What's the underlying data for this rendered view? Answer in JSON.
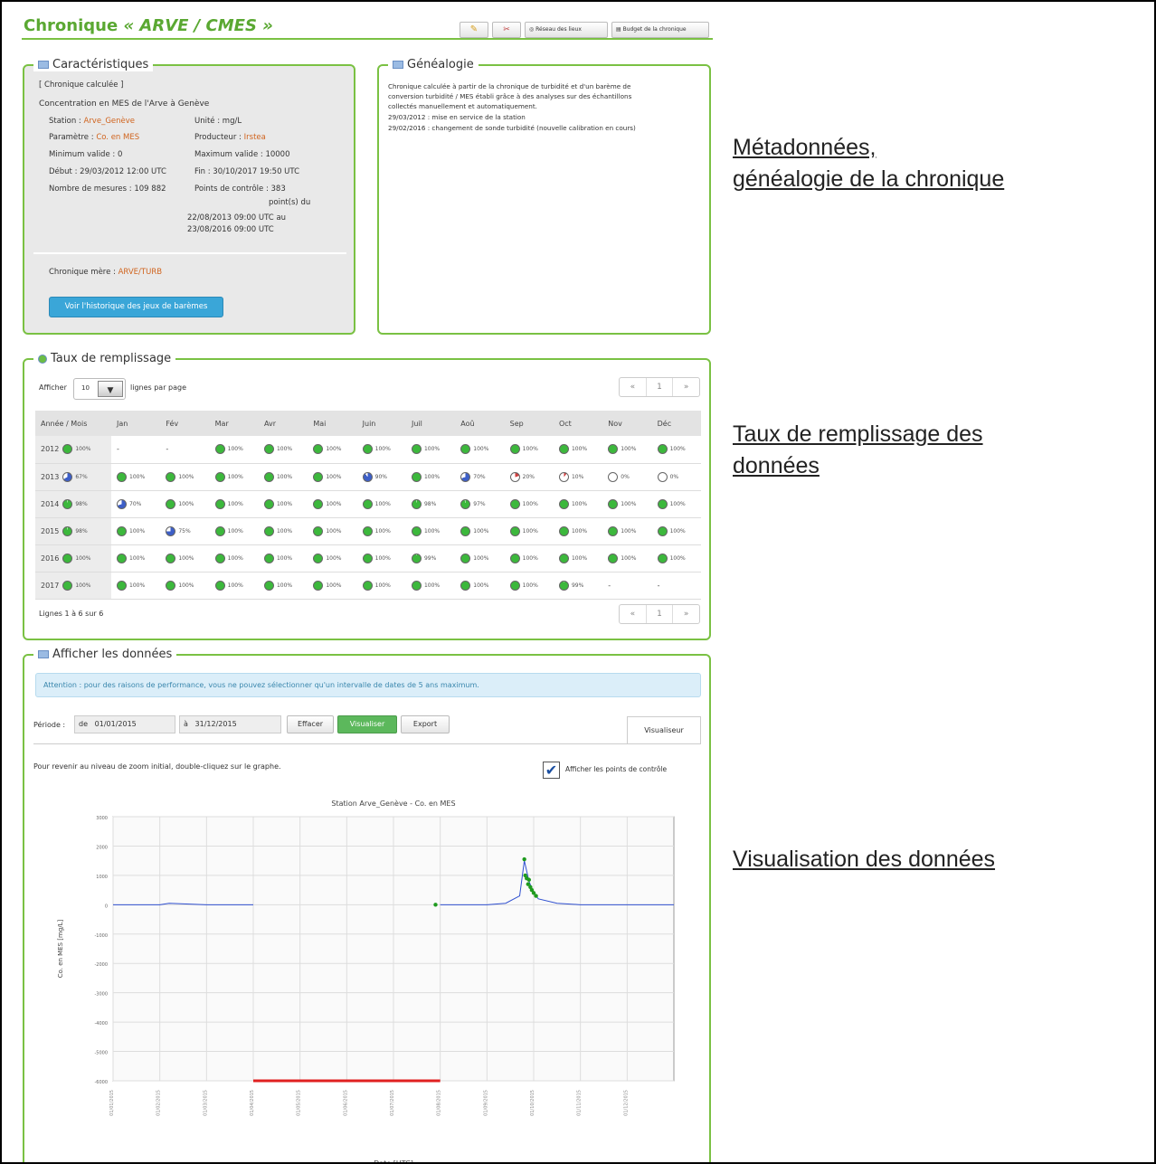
{
  "app": {
    "title_prefix": "Chronique ",
    "title_name": "« ARVE / CMES »",
    "toolbar": {
      "edit_icon": "pencil-icon",
      "extra_icon": "tools-icon",
      "network_label": "Réseau des lieux",
      "budget_label": "Budget de la chronique"
    }
  },
  "characteristics": {
    "legend": "Caractéristiques",
    "type": "[ Chronique calculée ]",
    "concentration": "Concentration en MES de l'Arve à Genève",
    "station_label": "Station :",
    "station_value": "Arve_Genève",
    "unit": "Unité : mg/L",
    "param_label": "Paramètre :",
    "param_value": "Co. en MES",
    "producer_label": "Producteur :",
    "producer_value": "Irstea",
    "min_valid": "Minimum valide : 0",
    "max_valid": "Maximum valide : 10000",
    "start": "Début : 29/03/2012 12:00 UTC",
    "end": "Fin : 30/10/2017 19:50 UTC",
    "measures": "Nombre de mesures : 109 882",
    "control1": "Points de contrôle : 383",
    "control2": "point(s) du",
    "control3": "22/08/2013 09:00 UTC au",
    "control4": "23/08/2016 09:00 UTC",
    "mother_label": "Chronique mère :",
    "mother_value": "ARVE/TURB",
    "history_button": "Voir l'historique des jeux de barèmes"
  },
  "genealogy": {
    "legend": "Généalogie",
    "lines": [
      "Chronique calculée à partir de la chronique de turbidité et d'un barème de",
      "conversion turbidité / MES établi grâce à des analyses sur des échantillons",
      "collectés manuellement et automatiquement.",
      "29/03/2012 : mise en service de la station",
      "29/02/2016 : changement de sonde turbidité (nouvelle calibration en cours)"
    ]
  },
  "fill": {
    "legend": "Taux de remplissage",
    "show_label": "Afficher",
    "per_page_value": "10",
    "per_page_suffix": "lignes par page",
    "headers": [
      "Année / Mois",
      "Jan",
      "Fév",
      "Mar",
      "Avr",
      "Mai",
      "Juin",
      "Juil",
      "Aoû",
      "Sep",
      "Oct",
      "Nov",
      "Déc"
    ],
    "rows": [
      {
        "year": "2012",
        "total": 100,
        "months": [
          null,
          null,
          100,
          100,
          100,
          100,
          100,
          100,
          100,
          100,
          100,
          100
        ]
      },
      {
        "year": "2013",
        "total": 67,
        "months": [
          100,
          100,
          100,
          100,
          100,
          90,
          100,
          70,
          20,
          10,
          0,
          0
        ]
      },
      {
        "year": "2014",
        "total": 98,
        "months": [
          70,
          100,
          100,
          100,
          100,
          100,
          98,
          97,
          100,
          100,
          100,
          100
        ]
      },
      {
        "year": "2015",
        "total": 98,
        "months": [
          100,
          75,
          100,
          100,
          100,
          100,
          100,
          100,
          100,
          100,
          100,
          100
        ]
      },
      {
        "year": "2016",
        "total": 100,
        "months": [
          100,
          100,
          100,
          100,
          100,
          100,
          99,
          100,
          100,
          100,
          100,
          100
        ]
      },
      {
        "year": "2017",
        "total": 100,
        "months": [
          100,
          100,
          100,
          100,
          100,
          100,
          100,
          100,
          100,
          99,
          null,
          null
        ]
      }
    ],
    "footer": "Lignes 1 à 6 sur 6",
    "pager": [
      "«",
      "1",
      "»"
    ]
  },
  "data_section": {
    "legend": "Afficher les données",
    "alert": "Attention : pour des raisons de performance, vous ne pouvez sélectionner qu'un intervalle de dates de 5 ans maximum.",
    "period_label": "Période :",
    "from_label": "de",
    "from_value": "01/01/2015",
    "to_label": "à",
    "to_value": "31/12/2015",
    "clear_button": "Effacer",
    "visualize_button": "Visualiser",
    "export_button": "Export",
    "viewer_tab": "Visualiseur",
    "zoom_hint": "Pour revenir au niveau de zoom initial, double-cliquez sur le graphe.",
    "control_points_label": "Afficher les points de contrôle",
    "control_points_checked": true
  },
  "chart_data": {
    "type": "line",
    "title": "Station Arve_Genève - Co. en MES",
    "xlabel": "Date [UTC]",
    "ylabel": "Co. en MES [mg/L]",
    "y_ticks": [
      "3000",
      "2000",
      "1000",
      "0",
      "-1000",
      "-2000",
      "-3000",
      "-4000",
      "-5000",
      "-6000"
    ],
    "x_ticks": [
      "01/01/2015",
      "01/02/2015",
      "01/03/2015",
      "01/04/2015",
      "01/05/2015",
      "01/06/2015",
      "01/07/2015",
      "01/08/2015",
      "01/09/2015",
      "01/10/2015",
      "01/11/2015",
      "01/12/2015"
    ],
    "ylim": [
      -6000,
      3000
    ],
    "series": [
      {
        "x": [
          0,
          1,
          1.2,
          2,
          3
        ],
        "y": [
          0,
          0,
          50,
          0,
          0
        ]
      },
      {
        "x": [
          7,
          8,
          8.4,
          8.7,
          8.8,
          8.9,
          9,
          9.1,
          9.5,
          10,
          11,
          12
        ],
        "y": [
          0,
          0,
          50,
          300,
          1500,
          800,
          400,
          200,
          50,
          0,
          0,
          0
        ]
      },
      {
        "x": [
          6.9,
          8.8,
          8.82,
          8.85,
          8.88,
          8.9,
          8.93,
          8.96,
          9,
          9.05
        ],
        "y": [
          0,
          1550,
          1000,
          900,
          700,
          850,
          600,
          500,
          400,
          300
        ]
      },
      {
        "x": [
          3,
          7
        ],
        "y": [
          -6000,
          -6000
        ]
      }
    ],
    "colors": [
      "#3050d0",
      "#3050d0",
      "#1e9a1e",
      "#e02020"
    ],
    "grid": true
  },
  "annotations": {
    "meta_line1": "Métadonnées,",
    "meta_line2": "généalogie de la chronique",
    "fill_line1": "Taux de remplissage des",
    "fill_line2": "données",
    "viz": "Visualisation des données"
  }
}
